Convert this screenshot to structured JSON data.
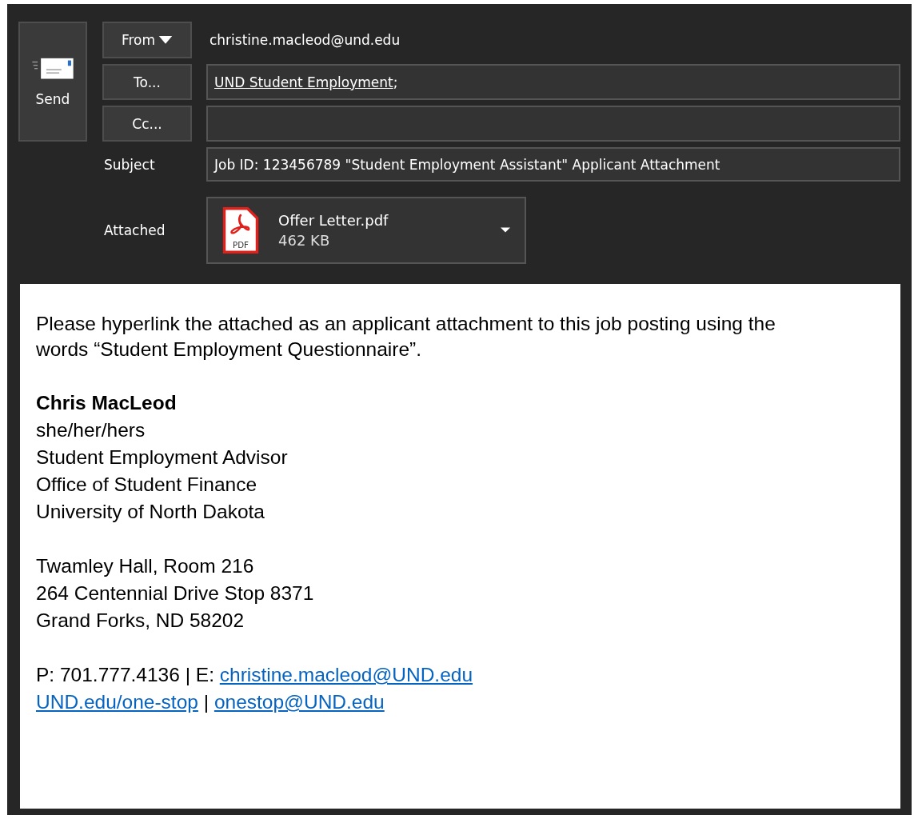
{
  "send_button": {
    "label": "Send"
  },
  "from": {
    "label": "From",
    "value": "christine.macleod@und.edu"
  },
  "to": {
    "label": "To...",
    "recipient": "UND Student Employment",
    "separator": ";"
  },
  "cc": {
    "label": "Cc..."
  },
  "subject": {
    "label": "Subject",
    "value": "Job ID: 123456789 \"Student Employment Assistant\" Applicant Attachment"
  },
  "attached": {
    "label": "Attached",
    "file": {
      "icon_text": "PDF",
      "name": "Offer Letter.pdf",
      "size": "462 KB"
    }
  },
  "body": {
    "message": "Please hyperlink the attached as an applicant attachment to this job posting using the words “Student Employment Questionnaire”.",
    "signature_name": "Chris MacLeod",
    "signature_lines": [
      "she/her/hers",
      "Student Employment Advisor",
      "Office of Student Finance",
      "University of North Dakota"
    ],
    "address_lines": [
      "Twamley Hall, Room 216",
      "264 Centennial Drive Stop 8371",
      "Grand Forks, ND 58202"
    ],
    "contact_lines": [
      [
        {
          "kind": "text",
          "text": "P: 701.777.4136 | E: "
        },
        {
          "kind": "link",
          "text": "christine.macleod@UND.edu"
        }
      ],
      [
        {
          "kind": "link",
          "text": "UND.edu/one-stop"
        },
        {
          "kind": "text",
          "text": " | "
        },
        {
          "kind": "link",
          "text": "onestop@UND.edu"
        }
      ]
    ]
  }
}
